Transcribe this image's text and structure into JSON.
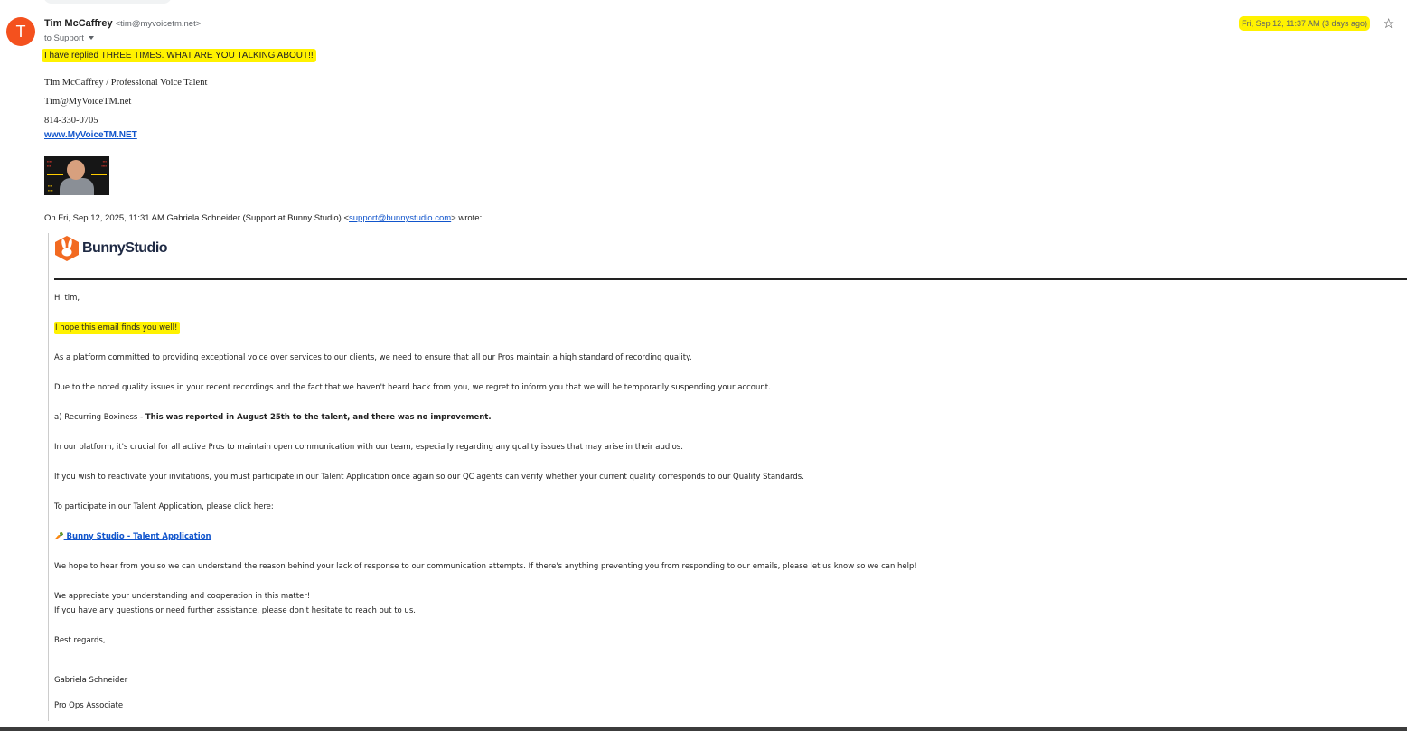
{
  "sender": {
    "avatar_letter": "T",
    "name": "Tim McCaffrey",
    "email": "<tim@myvoicetm.net>",
    "recipient": "to Support",
    "date": "Fri, Sep 12, 11:37 AM (3 days ago)"
  },
  "reply": {
    "text": "I have replied THREE TIMES. WHAT ARE YOU TALKING ABOUT!!"
  },
  "signature": {
    "line1": "Tim McCaffrey / Professional Voice Talent",
    "email": "Tim@MyVoiceTM.net",
    "phone": "814-330-0705",
    "website": "www.MyVoiceTM.NET"
  },
  "quoted": {
    "header_prefix": "On Fri, Sep 12, 2025, 11:31 AM Gabriela Schneider (Support at Bunny Studio) <",
    "header_email": "support@bunnystudio.com",
    "header_suffix": "> wrote:",
    "logo_text": "BunnyStudio",
    "greeting": "Hi tim,",
    "hope": "I hope this email finds you well!",
    "para1": "As a platform committed to providing exceptional voice over services to our clients, we need to ensure that all our Pros maintain a high standard of recording quality.",
    "para2": "Due to the noted quality issues in your recent recordings and the fact that we haven't heard back from you, we regret to inform you that we will be temporarily suspending your account.",
    "issue_prefix": "a) Recurring Boxiness - ",
    "issue_bold": "This was reported in August 25th to the talent, and there was no improvement.",
    "para3": "In our platform, it's crucial for all active Pros to maintain open communication with our team, especially regarding any quality issues that may arise in their audios.",
    "para4": "If you wish to reactivate your invitations, you must participate in our Talent Application once again so our QC agents can verify whether your current quality corresponds to our Quality Standards.",
    "para5": "To participate in our Talent Application, please click here:",
    "link_emoji": "🥕",
    "link_text": " Bunny Studio - Talent Application",
    "para6": "We hope to hear from you so we can understand the reason behind your lack of response to our communication attempts. If there's anything preventing you from responding to our emails, please let us know so we can help!",
    "para7": "We appreciate your understanding and cooperation in this matter!",
    "para8": "If you have any questions or need further assistance, please don't hesitate to reach out to us.",
    "closing": "Best regards,",
    "signer_name": "Gabriela Schneider",
    "signer_title": "Pro Ops Associate"
  },
  "colors": {
    "highlight": "#fff200",
    "avatar": "#f4511e",
    "link": "#1155cc",
    "bunny_orange": "#f26a21"
  },
  "icons": [
    "star-icon",
    "dropdown-caret-icon",
    "bunny-logo-icon",
    "carrot-emoji"
  ]
}
